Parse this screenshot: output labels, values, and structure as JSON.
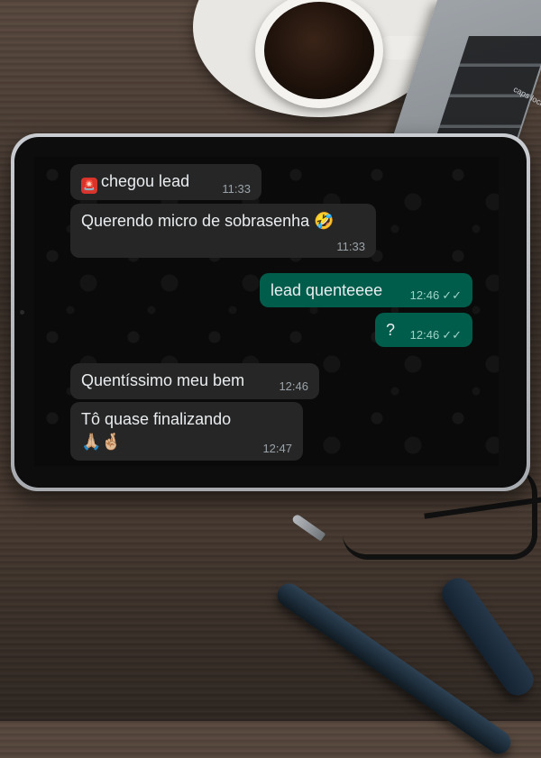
{
  "desk": {
    "caps_key_label": "caps lock"
  },
  "chat": {
    "messages": [
      {
        "direction": "incoming",
        "icon": "siren-emoji",
        "text": "chegou lead",
        "time": "11:33"
      },
      {
        "direction": "incoming",
        "icon": "rofl-emoji",
        "text": "Querendo micro de sobrasenha",
        "emoji": "🤣",
        "time": "11:33"
      },
      {
        "direction": "outgoing",
        "text": "lead quenteeee",
        "time": "12:46",
        "status": "read"
      },
      {
        "direction": "outgoing",
        "text": "?",
        "time": "12:46",
        "status": "read"
      },
      {
        "direction": "incoming",
        "text": "Quentíssimo meu bem",
        "time": "12:46"
      },
      {
        "direction": "incoming",
        "text": "Tô quase finalizando",
        "emoji": "🙏🏼🤞🏼",
        "time": "12:47"
      }
    ],
    "read_ticks": "✓✓",
    "colors": {
      "incoming_bubble": "#262626",
      "outgoing_bubble": "#005c4b",
      "background": "#0a0a0a",
      "text": "#e9edef"
    }
  }
}
